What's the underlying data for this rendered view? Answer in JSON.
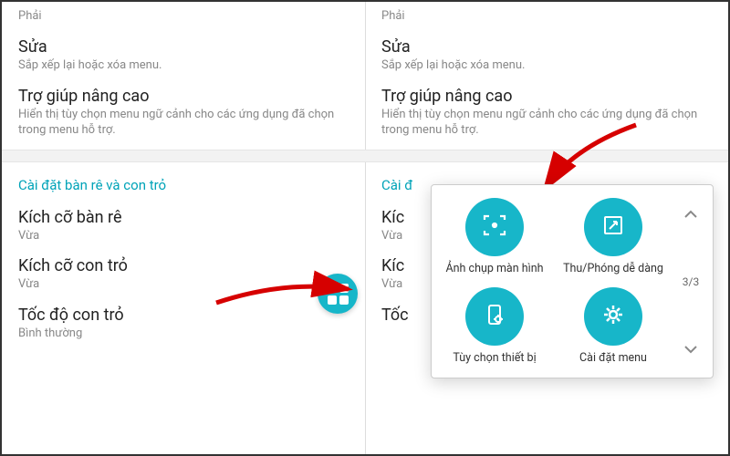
{
  "left": {
    "item0_sub": "Phải",
    "edit": {
      "title": "Sửa",
      "sub": "Sắp xếp lại hoặc xóa menu."
    },
    "adv": {
      "title": "Trợ giúp nâng cao",
      "sub": "Hiển thị tùy chọn menu ngữ cảnh cho các ứng dụng đã chọn trong menu hỗ trợ."
    },
    "section": "Cài đặt bàn rê và con trỏ",
    "padsize": {
      "title": "Kích cỡ bàn rê",
      "sub": "Vừa"
    },
    "ptrsize": {
      "title": "Kích cỡ con trỏ",
      "sub": "Vừa"
    },
    "ptrspeed": {
      "title": "Tốc độ con trỏ",
      "sub": "Bình thường"
    }
  },
  "right": {
    "item0_sub": "Phải",
    "edit": {
      "title": "Sửa",
      "sub": "Sắp xếp lại hoặc xóa menu."
    },
    "adv": {
      "title": "Trợ giúp nâng cao",
      "sub": "Hiển thị tùy chọn menu ngữ cảnh cho các ứng dụng đã chọn trong menu hỗ trợ."
    },
    "section": "Cài đ",
    "padsize": {
      "title": "Kíc",
      "sub": "Vừa"
    },
    "ptrsize": {
      "title": "Kíc",
      "sub": "Vừa"
    },
    "ptrspeed": {
      "title": "Tốc"
    }
  },
  "popup": {
    "items": [
      {
        "label": "Ảnh chụp màn hình",
        "icon": "screenshot-icon"
      },
      {
        "label": "Thu/Phóng dễ dàng",
        "icon": "zoom-icon"
      },
      {
        "label": "Tùy chọn thiết bị",
        "icon": "device-options-icon"
      },
      {
        "label": "Cài đặt menu",
        "icon": "settings-icon"
      }
    ],
    "pager": "3/3"
  }
}
